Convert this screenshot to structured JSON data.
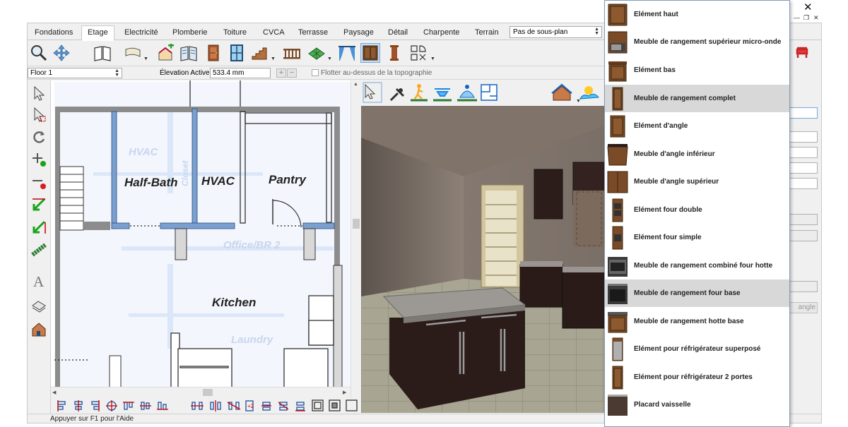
{
  "tabs": [
    {
      "label": "Fondations"
    },
    {
      "label": "Etage"
    },
    {
      "label": "Electricité"
    },
    {
      "label": "Plomberie"
    },
    {
      "label": "Toiture"
    },
    {
      "label": "CVCA"
    },
    {
      "label": "Terrasse"
    },
    {
      "label": "Paysage"
    },
    {
      "label": "Détail"
    },
    {
      "label": "Charpente"
    },
    {
      "label": "Terrain"
    }
  ],
  "active_tab": "Etage",
  "plan_select": {
    "value": "Pas de sous-plan"
  },
  "options_bar": {
    "floor": "Floor 1",
    "elevation_label": "Élevation Active:",
    "elevation_value": "533.4 mm",
    "float_label": "Flotter au-dessus de la topographie"
  },
  "plan": {
    "rooms": [
      "Half-Bath",
      "HVAC",
      "Pantry",
      "Kitchen"
    ],
    "underlay_labels": [
      "HVAC",
      "Closet",
      "Office/BR 2",
      "Laundry"
    ]
  },
  "right_panel": {
    "button_fragment": "angle"
  },
  "dropdown": {
    "items": [
      {
        "label": "Elément haut",
        "icon": "upper-cabinet-icon"
      },
      {
        "label": "Meuble de rangement supérieur micro-onde",
        "icon": "microwave-cabinet-icon"
      },
      {
        "label": "Elément bas",
        "icon": "base-cabinet-icon"
      },
      {
        "label": "Meuble de rangement complet",
        "icon": "full-height-cabinet-icon",
        "highlighted": true
      },
      {
        "label": "Elément d'angle",
        "icon": "corner-cabinet-icon"
      },
      {
        "label": "Meuble d'angle inférieur",
        "icon": "lower-corner-cabinet-icon"
      },
      {
        "label": "Meuble d'angle supérieur",
        "icon": "upper-corner-cabinet-icon"
      },
      {
        "label": "Elément four double",
        "icon": "double-oven-icon"
      },
      {
        "label": "Elément four simple",
        "icon": "single-oven-icon"
      },
      {
        "label": "Meuble de rangement combiné four hotte",
        "icon": "oven-hood-combo-icon"
      },
      {
        "label": "Meuble de rangement four base",
        "icon": "oven-base-cabinet-icon",
        "highlighted": true
      },
      {
        "label": "Meuble de rangement hotte base",
        "icon": "hood-base-cabinet-icon"
      },
      {
        "label": "Elément pour réfrigérateur superposé",
        "icon": "stacked-fridge-icon"
      },
      {
        "label": "Elément pour réfrigérateur 2 portes",
        "icon": "two-door-fridge-icon"
      },
      {
        "label": "Placard vaisselle",
        "icon": "dish-cupboard-icon"
      }
    ]
  },
  "status": {
    "help": "Appuyer sur F1 pour l'Aide"
  },
  "colors": {
    "accent": "#7aa7d6",
    "wall_blue": "#7aa0d0",
    "cabinet_brown": "#7b4a26",
    "highlight": "#d8d8d8"
  }
}
